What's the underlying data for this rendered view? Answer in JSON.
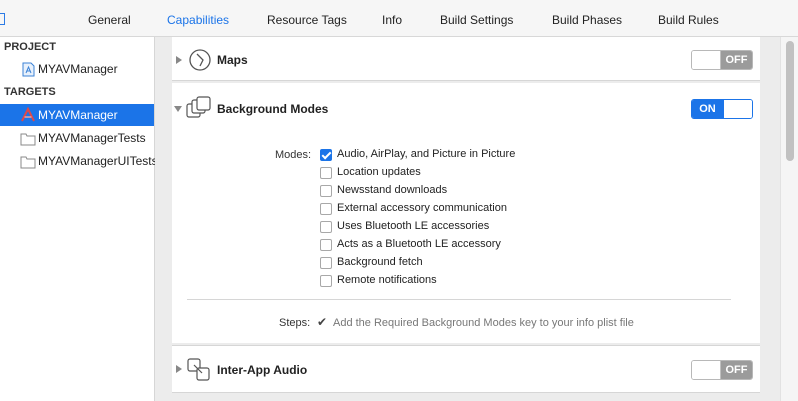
{
  "tabs": [
    {
      "label": "General",
      "active": false
    },
    {
      "label": "Capabilities",
      "active": true
    },
    {
      "label": "Resource Tags",
      "active": false
    },
    {
      "label": "Info",
      "active": false
    },
    {
      "label": "Build Settings",
      "active": false
    },
    {
      "label": "Build Phases",
      "active": false
    },
    {
      "label": "Build Rules",
      "active": false
    }
  ],
  "sidebar": {
    "project_header": "PROJECT",
    "project_item": "MYAVManager",
    "targets_header": "TARGETS",
    "targets": [
      {
        "label": "MYAVManager",
        "selected": true,
        "icon": "app-target-icon"
      },
      {
        "label": "MYAVManagerTests",
        "selected": false,
        "icon": "folder-icon"
      },
      {
        "label": "MYAVManagerUITests",
        "selected": false,
        "icon": "folder-icon"
      }
    ]
  },
  "capabilities": {
    "maps": {
      "title": "Maps",
      "state": "OFF",
      "icon": "maps-icon"
    },
    "background_modes": {
      "title": "Background Modes",
      "state": "ON",
      "icon": "background-modes-icon",
      "modes_label": "Modes:",
      "modes": [
        {
          "label": "Audio, AirPlay, and Picture in Picture",
          "checked": true
        },
        {
          "label": "Location updates",
          "checked": false
        },
        {
          "label": "Newsstand downloads",
          "checked": false
        },
        {
          "label": "External accessory communication",
          "checked": false
        },
        {
          "label": "Uses Bluetooth LE accessories",
          "checked": false
        },
        {
          "label": "Acts as a Bluetooth LE accessory",
          "checked": false
        },
        {
          "label": "Background fetch",
          "checked": false
        },
        {
          "label": "Remote notifications",
          "checked": false
        }
      ],
      "steps_label": "Steps:",
      "steps_check": "✔",
      "steps_text": "Add the Required Background Modes key to your info plist file"
    },
    "inter_app_audio": {
      "title": "Inter-App Audio",
      "state": "OFF",
      "icon": "inter-app-audio-icon"
    }
  },
  "colors": {
    "accent": "#1b74e8",
    "toggle_off": "#9b9b9b",
    "panel_bg": "#ececec"
  }
}
